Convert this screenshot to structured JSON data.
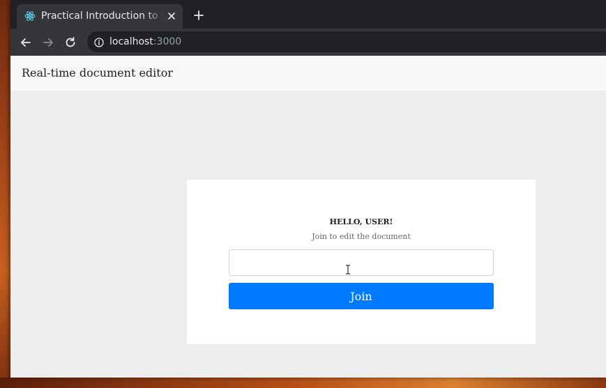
{
  "browser": {
    "tab": {
      "title": "Practical Introduction to WebSockets",
      "favicon": "react-icon",
      "close_icon": "close-icon"
    },
    "new_tab_icon": "plus-icon",
    "nav": {
      "back_icon": "arrow-left-icon",
      "forward_icon": "arrow-right-icon",
      "reload_icon": "reload-icon"
    },
    "address": {
      "info_icon": "info-icon",
      "host": "localhost",
      "port": ":3000"
    }
  },
  "app": {
    "header_title": "Real-time document editor",
    "login": {
      "greeting": "HELLO, USER!",
      "subtitle": "Join to edit the document",
      "input_value": "",
      "button_label": "Join"
    }
  },
  "colors": {
    "primary_button": "#007bff",
    "page_background": "#ededed",
    "header_background": "#f6f7f7",
    "chrome_dark": "#202124",
    "chrome_toolbar": "#35363a"
  }
}
